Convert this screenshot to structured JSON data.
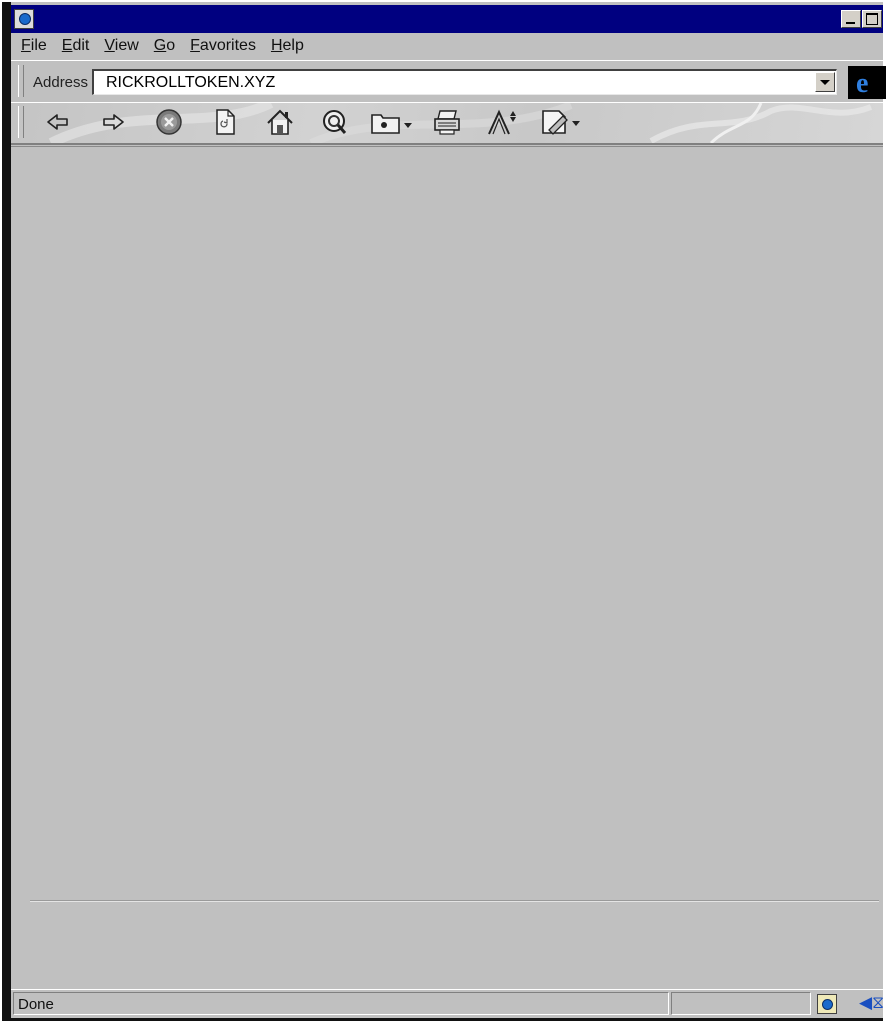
{
  "menubar": {
    "items": [
      "File",
      "Edit",
      "View",
      "Go",
      "Favorites",
      "Help"
    ]
  },
  "address": {
    "label": "Address",
    "value": "RICKROLLTOKEN.XYZ"
  },
  "toolbar": {
    "buttons": [
      {
        "name": "back",
        "icon": "arrow-left-icon"
      },
      {
        "name": "forward",
        "icon": "arrow-right-icon"
      },
      {
        "name": "stop",
        "icon": "stop-icon"
      },
      {
        "name": "refresh",
        "icon": "page-refresh-icon"
      },
      {
        "name": "home",
        "icon": "home-icon"
      },
      {
        "name": "search",
        "icon": "search-icon"
      },
      {
        "name": "favorites",
        "icon": "folder-icon"
      },
      {
        "name": "print",
        "icon": "printer-icon"
      },
      {
        "name": "font",
        "icon": "font-size-icon"
      },
      {
        "name": "edit",
        "icon": "edit-page-icon"
      }
    ]
  },
  "window": {
    "titlebar_color": "#000080",
    "chrome_color": "#c0c0c0",
    "accent": "#2f7fe0"
  },
  "ie_logo": "e",
  "status": {
    "text": "Done",
    "zone_icon": "internet-zone-icon"
  }
}
